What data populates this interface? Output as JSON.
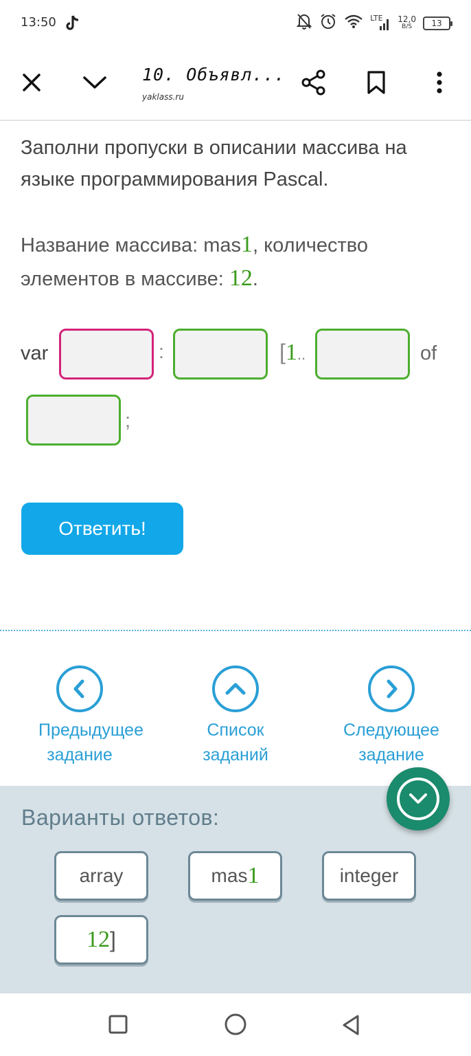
{
  "status_bar": {
    "time": "13:50",
    "network_type": "LTE",
    "net_speed_value": "12,0",
    "net_speed_unit": "B/S",
    "battery": "13",
    "icons": [
      "tiktok-icon",
      "bell-muted-icon",
      "alarm-icon",
      "wifi-icon",
      "signal-icon",
      "battery-icon"
    ]
  },
  "toolbar": {
    "title": "10. Объявл...",
    "subtitle": "yaklass.ru",
    "icons": [
      "close-icon",
      "chevron-down-icon",
      "share-icon",
      "bookmark-icon",
      "more-vert-icon"
    ]
  },
  "task": {
    "instruction": "Заполни пропуски в описании массива на языке программирования Pascal.",
    "desc_part1": "Название массива: mas",
    "desc_num1": "1",
    "desc_part2": ", количество элементов в массиве: ",
    "desc_num2": "12",
    "desc_part3": "."
  },
  "code": {
    "var": "var",
    "colon": ":",
    "bracket_open": "[",
    "bracket_num": "1",
    "range_dots": "..",
    "of": "of",
    "semicolon": ";"
  },
  "answer_button": {
    "label": "Ответить!"
  },
  "nav": {
    "prev_label": "Предыдущее задание",
    "list_label": "Список заданий",
    "next_label": "Следующее задание"
  },
  "answers": {
    "title": "Варианты ответов:",
    "chip_array": "array",
    "chip_mas_text": "mas",
    "chip_mas_num": "1",
    "chip_integer": "integer",
    "chip_12_num": "12",
    "chip_12_bracket": "]"
  },
  "colors": {
    "accent_blue": "#12a7e8",
    "link_blue": "#2a9fd6",
    "green_number": "#3a9a1c",
    "active_blank": "#d4237a",
    "blank_border": "#4cae2e",
    "fab": "#1a8b6c"
  },
  "android_nav": {
    "icons": [
      "recents-square-icon",
      "home-circle-icon",
      "back-triangle-icon"
    ]
  }
}
